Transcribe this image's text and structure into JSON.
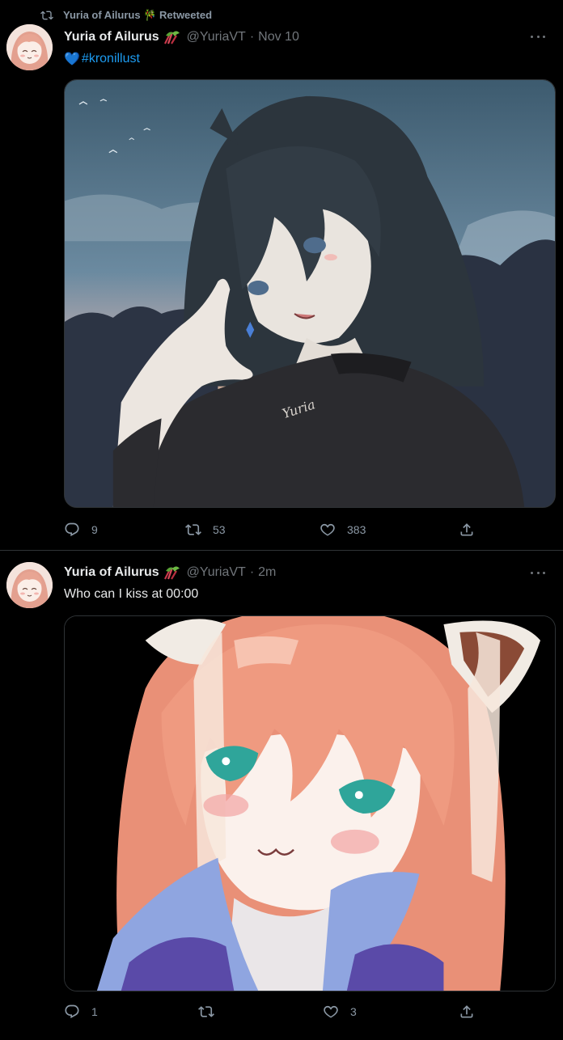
{
  "colors": {
    "accent": "#1d9bf0",
    "muted": "#71767b",
    "background": "#000000"
  },
  "tweets": [
    {
      "retweet_banner": "Yuria of Ailurus 🎋 Retweeted",
      "author_name": "Yuria of Ailurus",
      "author_emoji_icon": "rhubarb-emoji-icon",
      "handle": "@YuriaVT",
      "separator": "·",
      "time": "Nov 10",
      "text_emoji": "💙",
      "hashtag": "#kronillust",
      "image_desc_icon": "illustration-dark-hair-girl",
      "replies": "9",
      "retweets": "53",
      "likes": "383"
    },
    {
      "author_name": "Yuria of Ailurus",
      "author_emoji_icon": "rhubarb-emoji-icon",
      "handle": "@YuriaVT",
      "separator": "·",
      "time": "2m",
      "text": "Who can I kiss at 00:00",
      "image_desc_icon": "illustration-red-panda-girl",
      "replies": "1",
      "retweets": "",
      "likes": "3"
    }
  ]
}
